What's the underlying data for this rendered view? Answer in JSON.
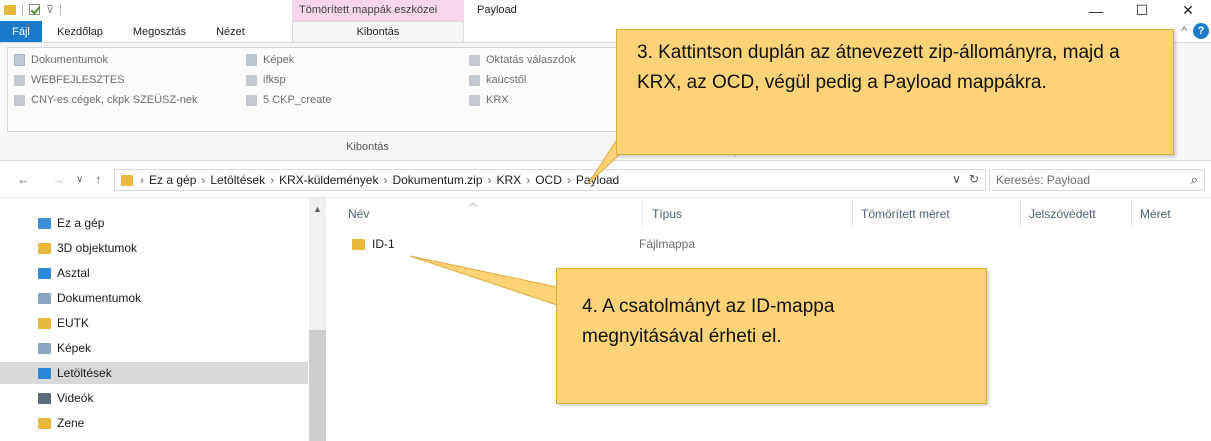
{
  "titlebar": {
    "context_tab": "Tömörített mappák eszközei",
    "window_title": "Payload",
    "buttons": {
      "minimize": "—",
      "maximize": "☐",
      "close": "✕"
    }
  },
  "ribbon_tabs": {
    "file": "Fájl",
    "tabs": [
      "Kezdőlap",
      "Megosztás",
      "Nézet"
    ],
    "active": "Kibontás"
  },
  "ribbon": {
    "gallery": [
      {
        "label": "Dokumentumok",
        "icon": "documents-icon"
      },
      {
        "label": "WEBFEJLESZTES",
        "icon": "folder-icon"
      },
      {
        "label": "CNY-es cégek, ckpk SZEÜSZ-nek",
        "icon": "folder-icon"
      },
      {
        "label": "Képek",
        "icon": "pictures-icon"
      },
      {
        "label": "ifksp",
        "icon": "folder-icon"
      },
      {
        "label": "5 CKP_create",
        "icon": "folder-icon"
      },
      {
        "label": "Oktatás válaszdok",
        "icon": "folder-icon"
      },
      {
        "label": "kaücstől",
        "icon": "folder-icon"
      },
      {
        "label": "KRX",
        "icon": "folder-icon"
      }
    ],
    "group_label": "Kibontás"
  },
  "address": {
    "crumbs": [
      "Ez a gép",
      "Letöltések",
      "KRX-küldemények",
      "Dokumentum.zip",
      "KRX",
      "OCD",
      "Payload"
    ],
    "search_placeholder": "Keresés: Payload"
  },
  "nav": {
    "items": [
      {
        "label": "Ez a gép",
        "icon": "computer-icon",
        "color": "#3d8fd6"
      },
      {
        "label": "3D objektumok",
        "icon": "3d-objects-icon",
        "color": "#e8b93c"
      },
      {
        "label": "Asztal",
        "icon": "desktop-icon",
        "color": "#2b88d8"
      },
      {
        "label": "Dokumentumok",
        "icon": "documents-icon",
        "color": "#8aa4c0"
      },
      {
        "label": "EUTK",
        "icon": "folder-icon",
        "color": "#e8b93c"
      },
      {
        "label": "Képek",
        "icon": "pictures-icon",
        "color": "#8aa4c0"
      },
      {
        "label": "Letöltések",
        "icon": "downloads-icon",
        "color": "#2b88d8"
      },
      {
        "label": "Videók",
        "icon": "videos-icon",
        "color": "#5b6b7b"
      },
      {
        "label": "Zene",
        "icon": "music-icon",
        "color": "#e8b93c"
      }
    ],
    "selected_index": 6
  },
  "files": {
    "columns": [
      "Név",
      "Típus",
      "Tömörített méret",
      "Jelszóvédett",
      "Méret"
    ],
    "rows": [
      {
        "name": "ID-1",
        "type": "Fájlmappa"
      }
    ]
  },
  "callouts": {
    "step3": "3. Kattintson duplán az átnevezett zip-állományra, majd a KRX, az OCD, végül pedig a Payload mappákra.",
    "step4": "4. A csatolmányt az ID-mappa megnyitásával érheti el."
  },
  "colors": {
    "accent": "#1979ca",
    "context_tab": "#f7d6ea",
    "callout_fill": "#fcd477",
    "callout_border": "#e0a93a",
    "folder": "#e8b93c"
  }
}
